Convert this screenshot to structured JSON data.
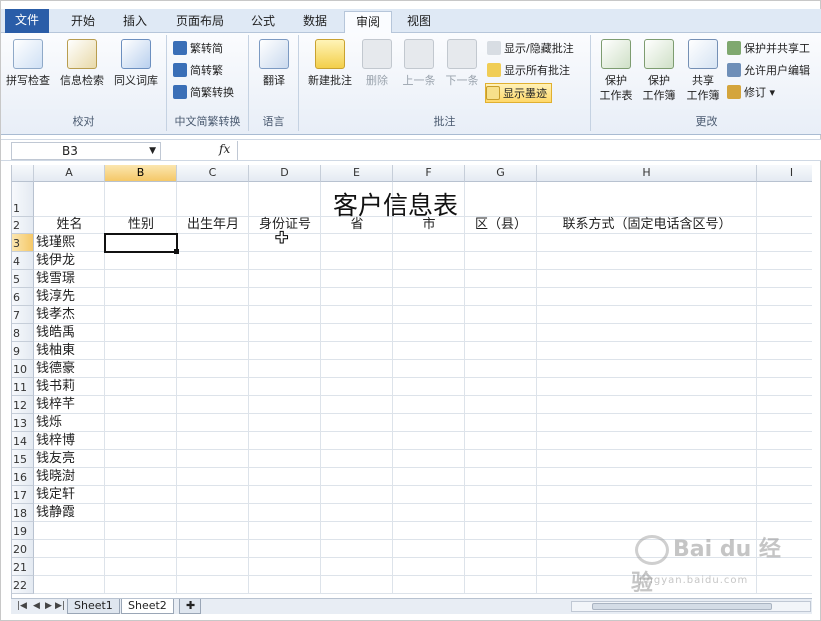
{
  "tabs": [
    {
      "label": "文件"
    },
    {
      "label": "开始"
    },
    {
      "label": "插入"
    },
    {
      "label": "页面布局"
    },
    {
      "label": "公式"
    },
    {
      "label": "数据"
    },
    {
      "label": "审阅"
    },
    {
      "label": "视图"
    }
  ],
  "ribbon": {
    "proofing": {
      "title": "校对",
      "spell": "拼写检查",
      "research": "信息检索",
      "thesaurus": "同义词库"
    },
    "chinese": {
      "title": "中文简繁转换",
      "to_simplified": "繁转简",
      "to_traditional": "简转繁",
      "convert": "简繁转换"
    },
    "language": {
      "title": "语言",
      "translate": "翻译"
    },
    "comments": {
      "title": "批注",
      "new": "新建批注",
      "delete": "删除",
      "previous": "上一条",
      "next": "下一条",
      "show_hide": "显示/隐藏批注",
      "show_all": "显示所有批注",
      "show_ink": "显示墨迹"
    },
    "changes": {
      "title": "更改",
      "protect_sheet_1": "保护",
      "protect_sheet_2": "工作表",
      "protect_wb_1": "保护",
      "protect_wb_2": "工作簿",
      "share_wb_1": "共享",
      "share_wb_2": "工作簿",
      "protect_share": "保护并共享工",
      "allow_edit": "允许用户编辑",
      "track": "修订"
    }
  },
  "formula_bar": {
    "name_box": "B3",
    "fx": "fx",
    "value": ""
  },
  "columns": [
    "A",
    "B",
    "C",
    "D",
    "E",
    "F",
    "G",
    "H",
    "I"
  ],
  "rows": [
    "1",
    "2",
    "3",
    "4",
    "5",
    "6",
    "7",
    "8",
    "9",
    "10",
    "11",
    "12",
    "13",
    "14",
    "15",
    "16",
    "17",
    "18",
    "19",
    "20",
    "21",
    "22"
  ],
  "sheet": {
    "title": "客户信息表",
    "headers": [
      "姓名",
      "性别",
      "出生年月",
      "身份证号",
      "省",
      "市",
      "区（县）",
      "联系方式（固定电话含区号）"
    ],
    "names": [
      "钱瑾熙",
      "钱伊龙",
      "钱雪璟",
      "钱淳先",
      "钱孝杰",
      "钱皓禹",
      "钱柚東",
      "钱德豪",
      "钱书莉",
      "钱梓芊",
      "钱烁",
      "钱梓博",
      "钱友亮",
      "钱晓澍",
      "钱定轩",
      "钱静霞"
    ]
  },
  "sheet_tabs": [
    "Sheet1",
    "Sheet2"
  ],
  "watermark": {
    "text": "Bai du 经验",
    "sub": "jingyan.baidu.com"
  }
}
